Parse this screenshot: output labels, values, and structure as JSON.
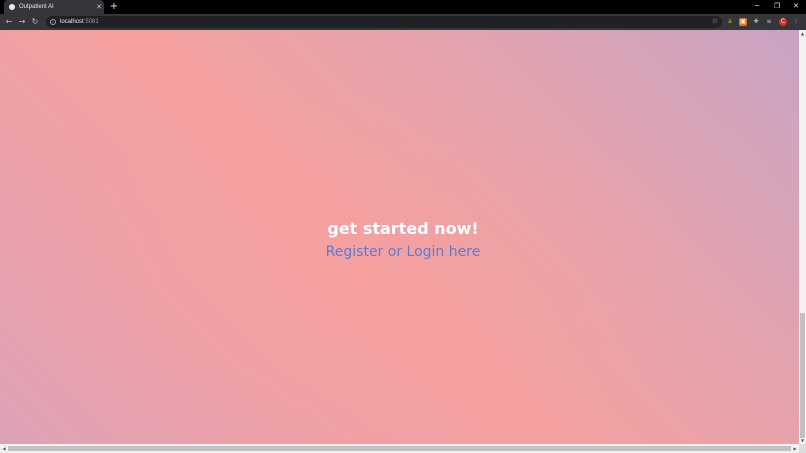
{
  "browser": {
    "tab": {
      "title": "Outpatient AI",
      "favicon": "globe-icon",
      "close": "✕"
    },
    "new_tab": "+",
    "window_controls": {
      "minimize": "─",
      "restore": "❐",
      "close": "✕"
    },
    "nav": {
      "back": "←",
      "forward": "→",
      "reload": "↻"
    },
    "address": {
      "host": "localhost",
      "port": ":5081",
      "info_icon": "i",
      "star": "☆"
    },
    "extensions": [
      {
        "icon": "a",
        "color": "#f2b400"
      },
      {
        "icon": "▣",
        "color": "#e2711d"
      },
      {
        "icon": "✚",
        "color": "#bdc1c6"
      },
      {
        "icon": "≡",
        "color": "#bdc1c6"
      },
      {
        "icon": "C",
        "color": "#d93025"
      },
      {
        "icon": "⋮",
        "color": "#bdc1c6"
      }
    ]
  },
  "page": {
    "headline": "get started now!",
    "cta": "Register or Login here",
    "colors": {
      "headline": "#ffffff",
      "cta": "#5b7bd5",
      "gradient_pink": "#f5a0a0",
      "gradient_mauve": "#c9a3c4"
    }
  },
  "scrollbars": {
    "vertical": {
      "up": "▲",
      "down": "▼"
    },
    "horizontal": {
      "left": "◀",
      "right": "▶"
    }
  }
}
